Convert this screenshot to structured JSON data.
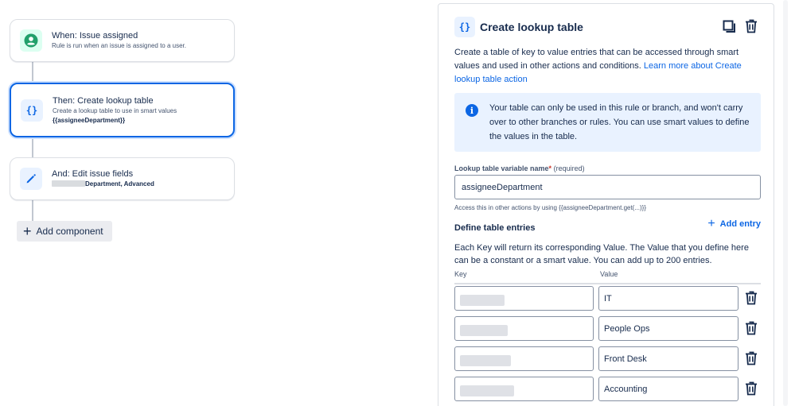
{
  "rule": {
    "trigger": {
      "title": "When: Issue assigned",
      "subtitle": "Rule is run when an issue is assigned to a user."
    },
    "action": {
      "title": "Then: Create lookup table",
      "subtitle": "Create a lookup table to use in smart values",
      "smart_value": "{{assigneeDepartment}}"
    },
    "edit": {
      "title": "And: Edit issue fields",
      "fields_text": "Department, Advanced"
    },
    "add_component_label": "Add component"
  },
  "panel": {
    "title": "Create lookup table",
    "icon_glyph": "{}",
    "description": "Create a table of key to value entries that can be accessed through smart values and used in other actions and conditions.",
    "learn_more": "Learn more about Create lookup table action",
    "info": "Your table can only be used in this rule or branch, and won't carry over to other branches or rules. You can use smart values to define the values in the table.",
    "variable_label": "Lookup table variable name",
    "required_mark": "*",
    "required_text": "(required)",
    "variable_value": "assigneeDepartment",
    "helper": "Access this in other actions by using {{assigneeDepartment.get(...)}}",
    "add_entry_label": "Add entry",
    "entries_title": "Define table entries",
    "entries_desc": "Each Key will return its corresponding Value. The Value that you define here can be a constant or a smart value. You can add up to 200 entries.",
    "key_header": "Key",
    "value_header": "Value",
    "entries": [
      {
        "value": "IT"
      },
      {
        "value": "People Ops"
      },
      {
        "value": "Front Desk"
      },
      {
        "value": "Accounting"
      }
    ]
  },
  "colors": {
    "accent": "#0c66e4",
    "trigger_icon": "#22a06b",
    "info_bg": "#e9f2ff",
    "text": "#172b4d"
  },
  "icons": [
    "user-circle-icon",
    "braces-icon",
    "pencil-icon",
    "plus-icon",
    "duplicate-icon",
    "trash-icon",
    "info-icon"
  ]
}
